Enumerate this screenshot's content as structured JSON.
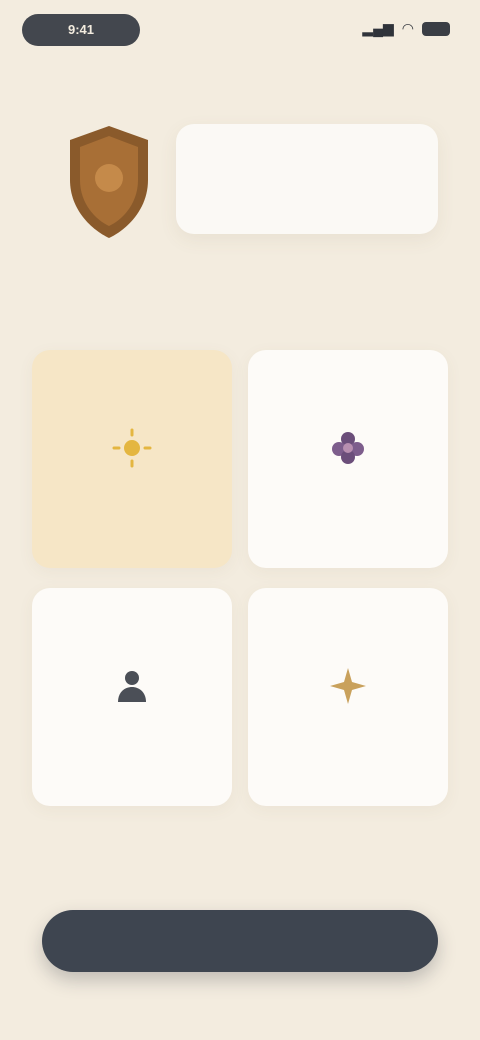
{
  "status_bar": {
    "time": "9:41"
  },
  "header": {
    "breadcrumb": ""
  },
  "hero": {
    "title": "",
    "subtitle": ""
  },
  "tiles": [
    {
      "label": "",
      "sub": "",
      "icon": "sun-icon",
      "selected": true,
      "accent": "#e4b640"
    },
    {
      "label": "",
      "sub": "",
      "icon": "flower-icon",
      "selected": false,
      "accent": "#6b4e7a"
    },
    {
      "label": "",
      "sub": "",
      "icon": "person-icon",
      "selected": false,
      "accent": "#4b4f57"
    },
    {
      "label": "",
      "sub": "",
      "icon": "spark-icon",
      "selected": false,
      "accent": "#c9a15c"
    }
  ],
  "cta": {
    "label": ""
  },
  "colors": {
    "background": "#f3ecdf",
    "selected_tile": "#f6e6c6",
    "button": "#3e4550",
    "shield": "#8a5a2b"
  }
}
